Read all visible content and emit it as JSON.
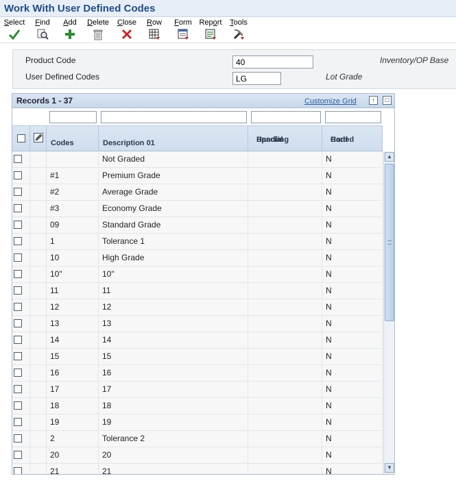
{
  "window": {
    "title": "Work With User Defined Codes"
  },
  "toolbar": {
    "items": [
      {
        "label": "Select",
        "underline": "S",
        "rest": "elect",
        "icon": "check-icon"
      },
      {
        "label": "Find",
        "underline": "F",
        "rest": "ind",
        "icon": "find-icon"
      },
      {
        "label": "Add",
        "underline": "A",
        "rest": "dd",
        "icon": "add-icon"
      },
      {
        "label": "Delete",
        "underline": "D",
        "rest": "elete",
        "icon": "trash-icon"
      },
      {
        "label": "Close",
        "underline": "C",
        "rest": "lose",
        "icon": "close-icon"
      },
      {
        "label": "Row",
        "underline": "R",
        "rest": "ow",
        "icon": "row-menu-icon"
      },
      {
        "label": "Form",
        "underline": "F",
        "rest": "orm",
        "icon": "form-menu-icon"
      },
      {
        "label": "Report",
        "prefix": "Rep",
        "underline": "o",
        "rest": "rt",
        "icon": "report-menu-icon"
      },
      {
        "label": "Tools",
        "underline": "T",
        "rest": "ools",
        "icon": "tools-menu-icon"
      }
    ]
  },
  "header": {
    "product_code_label": "Product Code",
    "product_code_value": "40",
    "product_code_desc": "Inventory/OP Base",
    "udc_label": "User Defined Codes",
    "udc_value": "LG",
    "udc_desc": "Lot Grade"
  },
  "grid": {
    "records_label": "Records 1 - 37",
    "customize_label": "Customize Grid",
    "columns": {
      "codes": "Codes",
      "description": "Description 01",
      "special_line1": "Special",
      "special_line2": "Handling",
      "hard_line1": "Hard",
      "hard_line2": "Coded"
    },
    "rows": [
      {
        "code": "",
        "description": "Not Graded",
        "special": "",
        "hard": "N"
      },
      {
        "code": "#1",
        "description": "Premium Grade",
        "special": "",
        "hard": "N"
      },
      {
        "code": "#2",
        "description": "Average Grade",
        "special": "",
        "hard": "N"
      },
      {
        "code": "#3",
        "description": "Economy Grade",
        "special": "",
        "hard": "N"
      },
      {
        "code": "09",
        "description": "Standard Grade",
        "special": "",
        "hard": "N"
      },
      {
        "code": "1",
        "description": "Tolerance 1",
        "special": "",
        "hard": "N"
      },
      {
        "code": "10",
        "description": "High Grade",
        "special": "",
        "hard": "N"
      },
      {
        "code": "10\"",
        "description": "10\"",
        "special": "",
        "hard": "N"
      },
      {
        "code": "11",
        "description": "11",
        "special": "",
        "hard": "N"
      },
      {
        "code": "12",
        "description": "12",
        "special": "",
        "hard": "N"
      },
      {
        "code": "13",
        "description": "13",
        "special": "",
        "hard": "N"
      },
      {
        "code": "14",
        "description": "14",
        "special": "",
        "hard": "N"
      },
      {
        "code": "15",
        "description": "15",
        "special": "",
        "hard": "N"
      },
      {
        "code": "16",
        "description": "16",
        "special": "",
        "hard": "N"
      },
      {
        "code": "17",
        "description": "17",
        "special": "",
        "hard": "N"
      },
      {
        "code": "18",
        "description": "18",
        "special": "",
        "hard": "N"
      },
      {
        "code": "19",
        "description": "19",
        "special": "",
        "hard": "N"
      },
      {
        "code": "2",
        "description": "Tolerance 2",
        "special": "",
        "hard": "N"
      },
      {
        "code": "20",
        "description": "20",
        "special": "",
        "hard": "N"
      },
      {
        "code": "21",
        "description": "21",
        "special": "",
        "hard": "N"
      }
    ]
  },
  "colors": {
    "title": "#1f4e89",
    "link": "#2a5fa5",
    "header_bg": "#dbe6f3"
  }
}
